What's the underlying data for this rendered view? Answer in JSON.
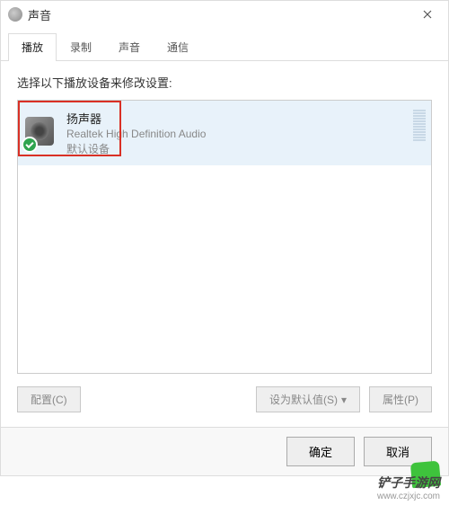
{
  "window": {
    "title": "声音"
  },
  "tabs": {
    "items": [
      {
        "label": "播放"
      },
      {
        "label": "录制"
      },
      {
        "label": "声音"
      },
      {
        "label": "通信"
      }
    ]
  },
  "instruction": "选择以下播放设备来修改设置:",
  "devices": [
    {
      "name": "扬声器",
      "description": "Realtek High Definition Audio",
      "status": "默认设备"
    }
  ],
  "buttons": {
    "configure": "配置(C)",
    "setDefault": "设为默认值(S)",
    "properties": "属性(P)",
    "ok": "确定",
    "cancel": "取消"
  },
  "watermark": {
    "cn": "铲子手游网",
    "url": "www.czjxjc.com"
  }
}
